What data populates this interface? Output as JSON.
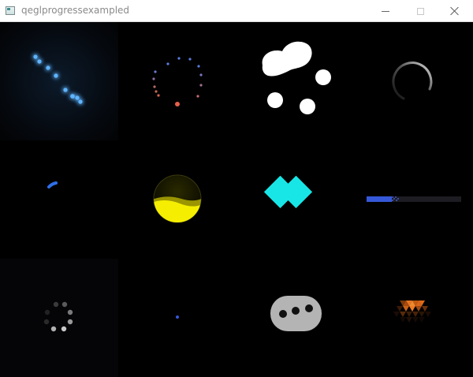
{
  "window": {
    "title": "qeglprogressexampled",
    "icon": "app-window-icon",
    "controls": [
      "minimize-icon",
      "maximize-icon",
      "close-icon"
    ]
  },
  "colors": {
    "background": "#000000",
    "glow_blue": "#4aa3ff",
    "dots_blue": "#5b7ce0",
    "dots_red": "#e8604a",
    "white": "#ffffff",
    "arc_grey": "#d6d6d6",
    "accent_blue": "#2f6fe8",
    "sphere_yellow": "#f5ee00",
    "cyan": "#18e6e6",
    "bar_blue": "#3558d8",
    "bar_track": "#1c1c22",
    "grey_dots": "#9a9a9a",
    "pill_grey": "#b4b4b4",
    "orange": "#e06a18"
  },
  "indicators": [
    {
      "name": "glowing-dots-line-indicator"
    },
    {
      "name": "colored-dot-ring-indicator"
    },
    {
      "name": "metaball-blob-indicator"
    },
    {
      "name": "arc-spinner-indicator"
    },
    {
      "name": "small-arc-indicator"
    },
    {
      "name": "liquid-sphere-indicator"
    },
    {
      "name": "diamond-grid-indicator"
    },
    {
      "name": "linear-bar-indicator"
    },
    {
      "name": "grey-dot-ring-indicator"
    },
    {
      "name": "single-dot-indicator"
    },
    {
      "name": "pill-dots-indicator"
    },
    {
      "name": "triangle-pyramid-indicator"
    }
  ]
}
